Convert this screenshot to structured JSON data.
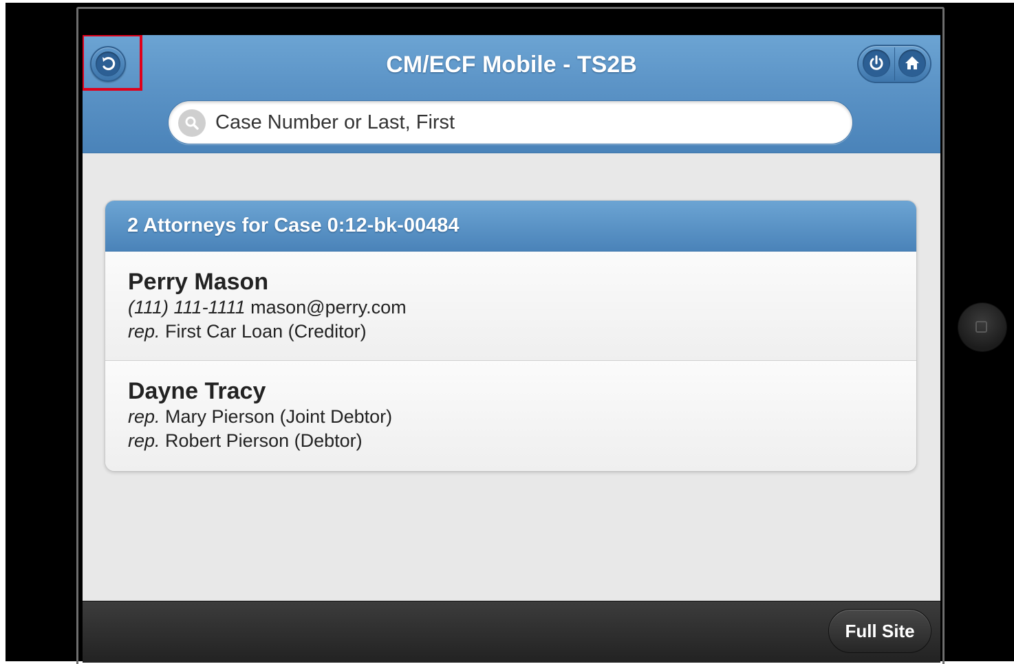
{
  "header": {
    "title": "CM/ECF Mobile - TS2B"
  },
  "search": {
    "placeholder": "Case Number or Last, First"
  },
  "list": {
    "heading": "2 Attorneys for Case 0:12-bk-00484",
    "attorneys": [
      {
        "name": "Perry Mason",
        "phone": "(111) 111-1111",
        "email": "mason@perry.com",
        "rep_prefix": "rep.",
        "reps": [
          "First Car Loan (Creditor)"
        ]
      },
      {
        "name": "Dayne Tracy",
        "rep_prefix": "rep.",
        "reps": [
          "Mary Pierson (Joint Debtor)",
          "Robert Pierson (Debtor)"
        ]
      }
    ]
  },
  "footer": {
    "full_site_label": "Full Site"
  },
  "icons": {
    "back": "back-arrow-icon",
    "power": "power-icon",
    "home": "home-icon",
    "search": "search-icon"
  },
  "colors": {
    "header_blue": "#5b93c6",
    "highlight_red": "#e0001a",
    "footer_dark": "#2a2a2a"
  }
}
